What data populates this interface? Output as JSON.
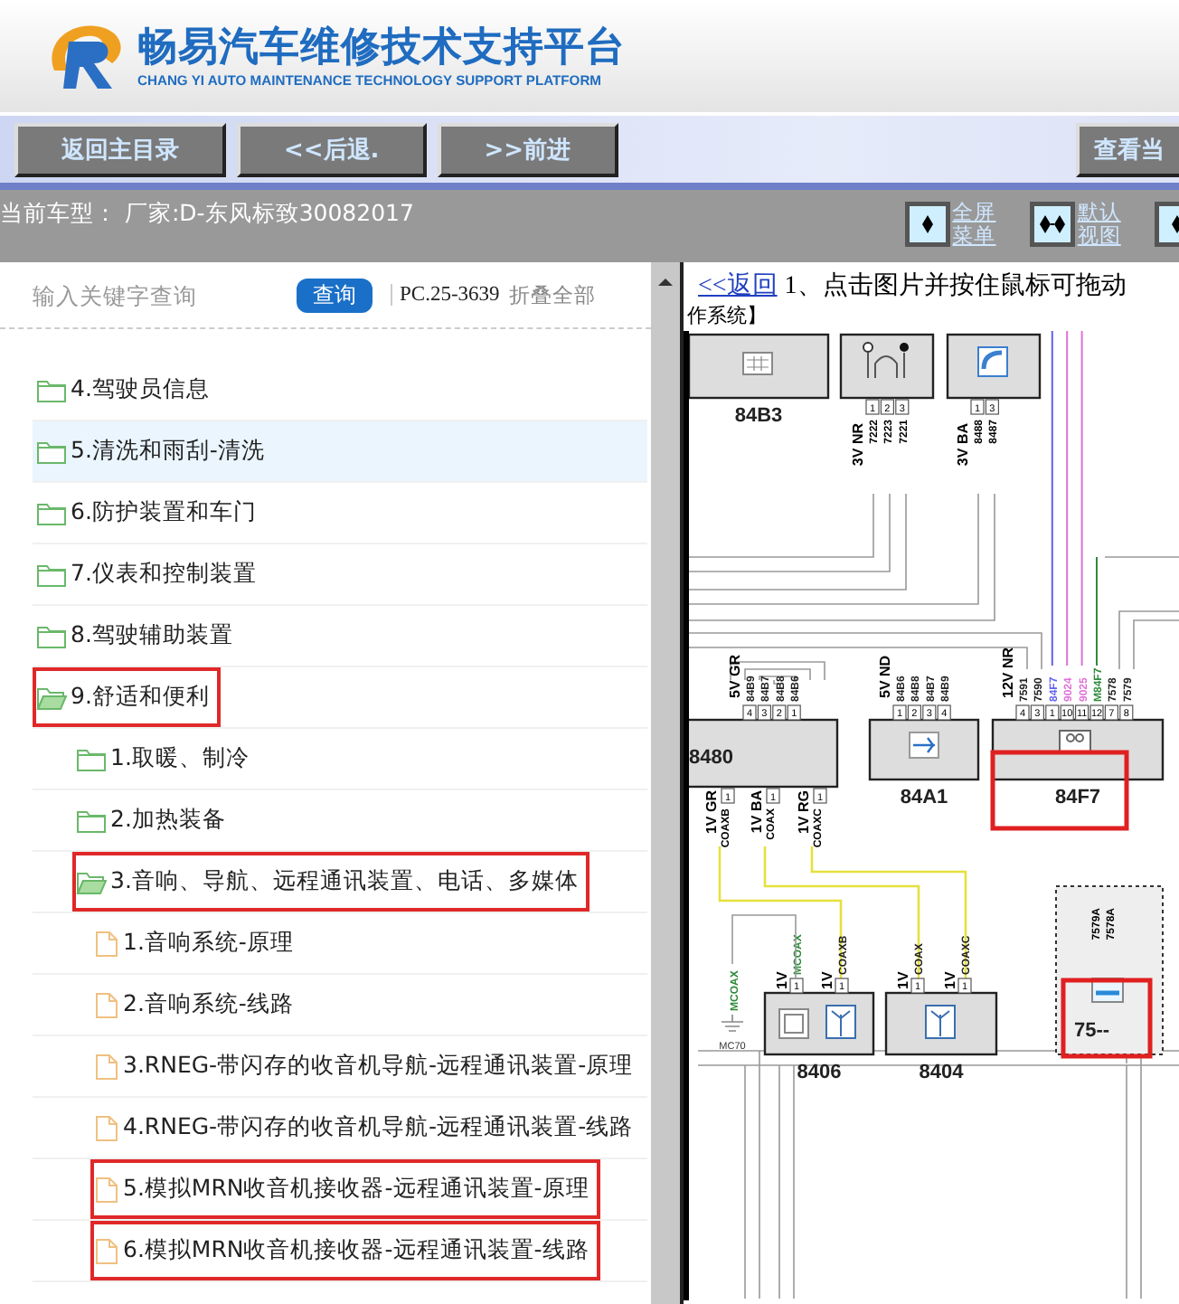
{
  "header": {
    "title": "畅易汽车维修技术支持平台",
    "subtitle": "CHANG YI AUTO MAINTENANCE TECHNOLOGY SUPPORT PLATFORM"
  },
  "nav_buttons": [
    "返回主目录",
    "<<后退.",
    ">>前进",
    "查看当"
  ],
  "info_bar": {
    "vehicle": "当前车型：  厂家:D-东风标致30082017",
    "view_buttons": [
      {
        "label": "全屏菜单",
        "kind": "single"
      },
      {
        "label": "默认视图",
        "kind": "double"
      }
    ]
  },
  "sidebar": {
    "search": {
      "placeholder": "输入关键字查询",
      "button": "查询"
    },
    "code": "PC.25-3639",
    "collapse_link": "折叠全部",
    "tree": [
      {
        "label": "4.驾驶员信息",
        "kind": "folder",
        "expanded": false,
        "selected": false,
        "highlighted": false
      },
      {
        "label": "5.清洗和雨刮-清洗",
        "kind": "folder",
        "expanded": false,
        "selected": true,
        "highlighted": false
      },
      {
        "label": "6.防护装置和车门",
        "kind": "folder",
        "expanded": false,
        "selected": false,
        "highlighted": false
      },
      {
        "label": "7.仪表和控制装置",
        "kind": "folder",
        "expanded": false,
        "selected": false,
        "highlighted": false
      },
      {
        "label": "8.驾驶辅助装置",
        "kind": "folder",
        "expanded": false,
        "selected": false,
        "highlighted": false
      },
      {
        "label": "9.舒适和便利",
        "kind": "folder",
        "expanded": true,
        "selected": false,
        "highlighted": true,
        "children": [
          {
            "label": "1.取暖、制冷",
            "kind": "folder",
            "expanded": false,
            "selected": false,
            "highlighted": false
          },
          {
            "label": "2.加热装备",
            "kind": "folder",
            "expanded": false,
            "selected": false,
            "highlighted": false
          },
          {
            "label": "3.音响、导航、远程通讯装置、电话、多媒体",
            "kind": "folder",
            "expanded": true,
            "selected": false,
            "highlighted": true,
            "children": [
              {
                "label": "1.音响系统-原理",
                "kind": "file",
                "selected": false,
                "highlighted": false
              },
              {
                "label": "2.音响系统-线路",
                "kind": "file",
                "selected": false,
                "highlighted": false
              },
              {
                "label": "3.RNEG-带闪存的收音机导航-远程通讯装置-原理",
                "kind": "file",
                "selected": false,
                "highlighted": false
              },
              {
                "label": "4.RNEG-带闪存的收音机导航-远程通讯装置-线路",
                "kind": "file",
                "selected": false,
                "highlighted": false
              },
              {
                "label": "5.模拟MRN收音机接收器-远程通讯装置-原理",
                "kind": "file",
                "selected": false,
                "highlighted": true
              },
              {
                "label": "6.模拟MRN收音机接收器-远程通讯装置-线路",
                "kind": "file",
                "selected": false,
                "highlighted": true
              }
            ]
          }
        ]
      }
    ]
  },
  "content": {
    "back_link": "<<返回",
    "instruction": "1、点击图片并按住鼠标可拖动",
    "caption": "作系统】",
    "diagram": {
      "components": [
        {
          "label": "84B3",
          "highlighted": false
        },
        {
          "highlighted": false,
          "group": "3V NR",
          "pins": [
            {
              "num": "1",
              "wire": "7222"
            },
            {
              "num": "2",
              "wire": "7223"
            },
            {
              "num": "3",
              "wire": "7221"
            }
          ]
        },
        {
          "highlighted": false,
          "group": "3V BA",
          "pins": [
            {
              "num": "1",
              "wire": "8488"
            },
            {
              "num": "3",
              "wire": "8487"
            }
          ]
        },
        {
          "label": "8480",
          "highlighted": false,
          "group": "5V GR",
          "pins": [
            {
              "num": "4",
              "wire": "84B9"
            },
            {
              "num": "3",
              "wire": "84B7"
            },
            {
              "num": "2",
              "wire": "84B8"
            },
            {
              "num": "1",
              "wire": "84B6"
            }
          ],
          "bottom_pins": [
            {
              "num": "1",
              "group": "1V GR",
              "wire": "COAXB",
              "color": "#e6e03c"
            },
            {
              "num": "1",
              "group": "1V BA",
              "wire": "COAX",
              "color": "#e6e03c"
            },
            {
              "num": "1",
              "group": "1V RG",
              "wire": "COAXC",
              "color": "#e6e03c"
            }
          ]
        },
        {
          "label": "84A1",
          "highlighted": false,
          "group": "5V ND",
          "pins": [
            {
              "num": "1",
              "wire": "84B6"
            },
            {
              "num": "2",
              "wire": "84B8"
            },
            {
              "num": "3",
              "wire": "84B7"
            },
            {
              "num": "4",
              "wire": "84B9"
            }
          ]
        },
        {
          "label": "84F7",
          "highlighted": true,
          "group": "12V NR",
          "pins": [
            {
              "num": "4",
              "wire": "7591"
            },
            {
              "num": "3",
              "wire": "7590"
            },
            {
              "num": "1",
              "wire": "84F7",
              "color": "#6060f0"
            },
            {
              "num": "10",
              "wire": "9024",
              "color": "#e070d8"
            },
            {
              "num": "11",
              "wire": "9025",
              "color": "#e070d8"
            },
            {
              "num": "12",
              "wire": "M84F7",
              "color": "#2e8b3a"
            },
            {
              "num": "7",
              "wire": "7578"
            },
            {
              "num": "8",
              "wire": "7579"
            }
          ]
        },
        {
          "label": "8406",
          "highlighted": false,
          "pins": [
            {
              "num": "1",
              "group": "1V",
              "wire": "MCOAX",
              "color": "#2e8b3a"
            },
            {
              "num": "1",
              "group": "1V",
              "wire": "COAXB"
            }
          ]
        },
        {
          "label": "8404",
          "highlighted": false,
          "pins": [
            {
              "num": "1",
              "group": "1V",
              "wire": "COAX"
            },
            {
              "num": "1",
              "group": "1V",
              "wire": "COAXC"
            }
          ]
        },
        {
          "label": "75--",
          "highlighted": true,
          "pins": [
            {
              "wire": "7579A"
            },
            {
              "wire": "7578A"
            }
          ]
        }
      ],
      "ground": {
        "wire": "MCOAX",
        "label": "MC70"
      }
    }
  }
}
